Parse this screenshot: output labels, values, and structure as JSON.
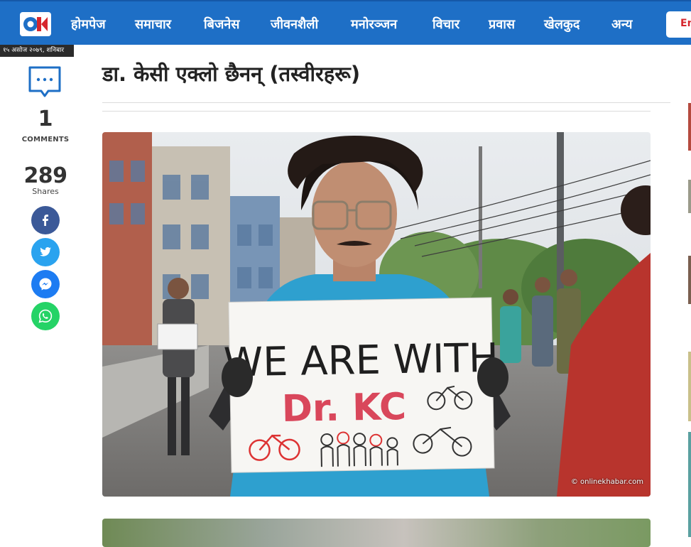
{
  "brand": {
    "logo_text": "OK"
  },
  "nav": {
    "items": [
      "होमपेज",
      "समाचार",
      "बिजनेस",
      "जीवनशैली",
      "मनोरञ्जन",
      "विचार",
      "प्रवास",
      "खेलकुद",
      "अन्य"
    ],
    "lang_button": "En"
  },
  "date": "१५ असोज २०७९, शनिबार",
  "share": {
    "comment_count": "1",
    "comment_label": "COMMENTS",
    "share_count": "289",
    "share_label": "Shares",
    "icons": [
      "facebook-icon",
      "twitter-icon",
      "messenger-icon",
      "whatsapp-icon"
    ]
  },
  "article": {
    "title": "डा. केसी एक्लो छैनन् (तस्वीरहरू)",
    "photo_credit": "© onlinekhabar.com",
    "sign_text": [
      "WE ARE WITH",
      "Dr. KC"
    ]
  },
  "colors": {
    "nav_bg": "#1e6fc6",
    "brand_red": "#d6262d",
    "facebook": "#3b5998",
    "twitter": "#2aa3ef",
    "messenger": "#1d7cf2",
    "whatsapp": "#25d366"
  }
}
